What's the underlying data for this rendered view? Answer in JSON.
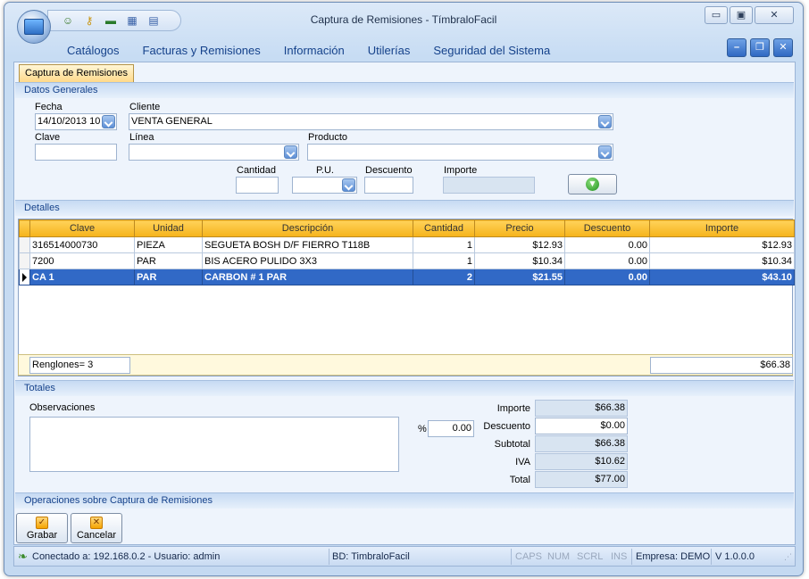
{
  "window": {
    "title": "Captura de Remisiones - TímbraloFacil",
    "controls": {
      "minimize": "▭",
      "restore": "▣",
      "close": "✕"
    }
  },
  "quick_access": [
    "users-icon",
    "key-icon",
    "money-icon",
    "calculator-icon",
    "document-icon"
  ],
  "menu": {
    "items": [
      "Catálogos",
      "Facturas y Remisiones",
      "Información",
      "Utilerías",
      "Seguridad del Sistema"
    ]
  },
  "mdi_controls": {
    "minimize": "–",
    "restore": "❐",
    "close": "✕"
  },
  "doc_tab": {
    "label": "Captura de Remisiones"
  },
  "general": {
    "header": "Datos Generales",
    "fecha_label": "Fecha",
    "fecha_value": "14/10/2013 10",
    "cliente_label": "Cliente",
    "cliente_value": "VENTA GENERAL",
    "clave_label": "Clave",
    "clave_value": "",
    "linea_label": "Línea",
    "linea_value": "",
    "producto_label": "Producto",
    "producto_value": "",
    "cantidad_label": "Cantidad",
    "cantidad_value": "",
    "pu_label": "P.U.",
    "pu_value": "",
    "descuento_label": "Descuento",
    "descuento_value": "",
    "importe_label": "Importe",
    "importe_value": ""
  },
  "details": {
    "header": "Detalles",
    "columns": [
      "Clave",
      "Unidad",
      "Descripción",
      "Cantidad",
      "Precio",
      "Descuento",
      "Importe"
    ],
    "rows": [
      {
        "clave": "316514000730",
        "unidad": "PIEZA",
        "descripcion": "SEGUETA BOSH D/F FIERRO T118B",
        "cantidad": "1",
        "precio": "$12.93",
        "descuento": "0.00",
        "importe": "$12.93"
      },
      {
        "clave": "7200",
        "unidad": "PAR",
        "descripcion": "BIS ACERO PULIDO 3X3",
        "cantidad": "1",
        "precio": "$10.34",
        "descuento": "0.00",
        "importe": "$10.34"
      },
      {
        "clave": "CA 1",
        "unidad": "PAR",
        "descripcion": "CARBON # 1 PAR",
        "cantidad": "2",
        "precio": "$21.55",
        "descuento": "0.00",
        "importe": "$43.10"
      }
    ],
    "selected_row": 2,
    "renglones": "Renglones= 3",
    "total": "$66.38"
  },
  "totals": {
    "header": "Totales",
    "observaciones_label": "Observaciones",
    "observaciones_value": "",
    "percent_symbol": "%",
    "percent_value": "0.00",
    "importe_label": "Importe",
    "importe_value": "$66.38",
    "descuento_label": "Descuento",
    "descuento_value": "$0.00",
    "subtotal_label": "Subtotal",
    "subtotal_value": "$66.38",
    "iva_label": "IVA",
    "iva_value": "$10.62",
    "total_label": "Total",
    "total_value": "$77.00"
  },
  "operations": {
    "header": "Operaciones sobre Captura de Remisiones",
    "grabar_label": "Grabar",
    "cancelar_label": "Cancelar"
  },
  "status_bar": {
    "connection": "Conectado a: 192.168.0.2 - Usuario: admin",
    "database": "BD: TimbraloFacil",
    "caps": "CAPS",
    "num": "NUM",
    "scrl": "SCRL",
    "ins": "INS",
    "empresa": "Empresa: DEMO",
    "version": "V 1.0.0.0"
  },
  "colors": {
    "accent": "#15428b",
    "grid_header": "#f5b31a",
    "selected_row": "#3169c6"
  }
}
